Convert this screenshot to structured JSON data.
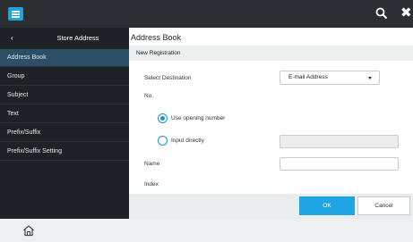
{
  "topbar": {
    "menu_icon": "hamburger-icon",
    "search_icon": "search-icon",
    "close_icon": "close-icon",
    "close_glyph": "✖"
  },
  "sidebar": {
    "back_glyph": "‹",
    "title": "Store Address",
    "items": [
      {
        "label": "Address Book",
        "active": true
      },
      {
        "label": "Group"
      },
      {
        "label": "Subject"
      },
      {
        "label": "Text"
      },
      {
        "label": "Prefix/Suffix"
      },
      {
        "label": "Prefix/Suffix Setting"
      }
    ]
  },
  "main": {
    "title": "Address Book",
    "subtitle": "New Registration",
    "select_destination": {
      "label": "Select Destination",
      "value": "E-mail Address"
    },
    "no_label": "No.",
    "options": {
      "use_opening": "Use opening number",
      "input_directly": "Input directly",
      "selected": "use_opening"
    },
    "name_label": "Name",
    "index_label": "Index"
  },
  "footer": {
    "ok": "OK",
    "cancel": "Cancel"
  },
  "colors": {
    "accent": "#1fa4e4",
    "sidebar_bg": "#1e2226",
    "sidebar_active": "#2b4f64",
    "topbar_bg": "#2b2f34"
  }
}
